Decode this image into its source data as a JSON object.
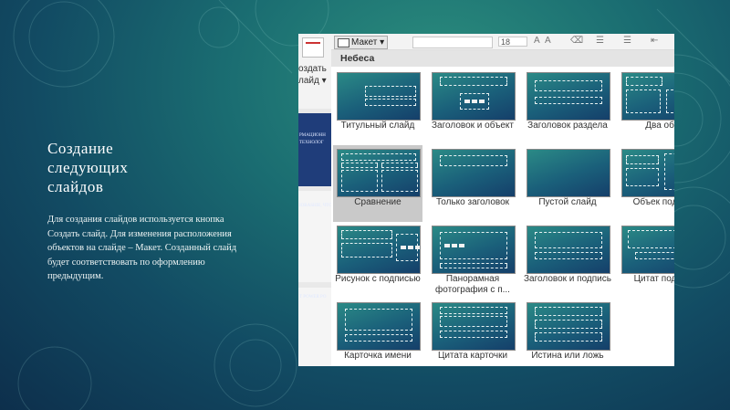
{
  "slide": {
    "title": "Создание\nследующих\nслайдов",
    "body": "Для создания слайдов используется кнопка Создать слайд. Для изменения расположения объектов на слайде – Макет. Созданный слайд будет соответствовать по оформлению предыдущим."
  },
  "screenshot": {
    "left_strip": {
      "label1": "оздать",
      "label2": "лайд ▾",
      "thumb_texts": [
        "РМАЦИОНН",
        "ТЕХНОЛОГ",
        "IOBASHIE, ЧТО",
        "Т POWER PO"
      ]
    },
    "toolbar": {
      "layout_button": "Макет ▾",
      "font_size": "18"
    },
    "gallery": {
      "theme_name": "Небеса",
      "layouts": [
        {
          "label": "Титульный слайд"
        },
        {
          "label": "Заголовок и объект"
        },
        {
          "label": "Заголовок раздела"
        },
        {
          "label": "Два объ"
        },
        {
          "label": "Сравнение",
          "selected": true
        },
        {
          "label": "Только заголовок"
        },
        {
          "label": "Пустой слайд"
        },
        {
          "label": "Объек подпис"
        },
        {
          "label": "Рисунок с подписью"
        },
        {
          "label": "Панорамная фотография с п..."
        },
        {
          "label": "Заголовок и подпись"
        },
        {
          "label": "Цитат подпис"
        },
        {
          "label": "Карточка имени"
        },
        {
          "label": "Цитата карточки"
        },
        {
          "label": "Истина или ложь"
        }
      ]
    },
    "colors": {
      "accent": "#1a5f7a",
      "selection": "#c9c9c9"
    }
  }
}
